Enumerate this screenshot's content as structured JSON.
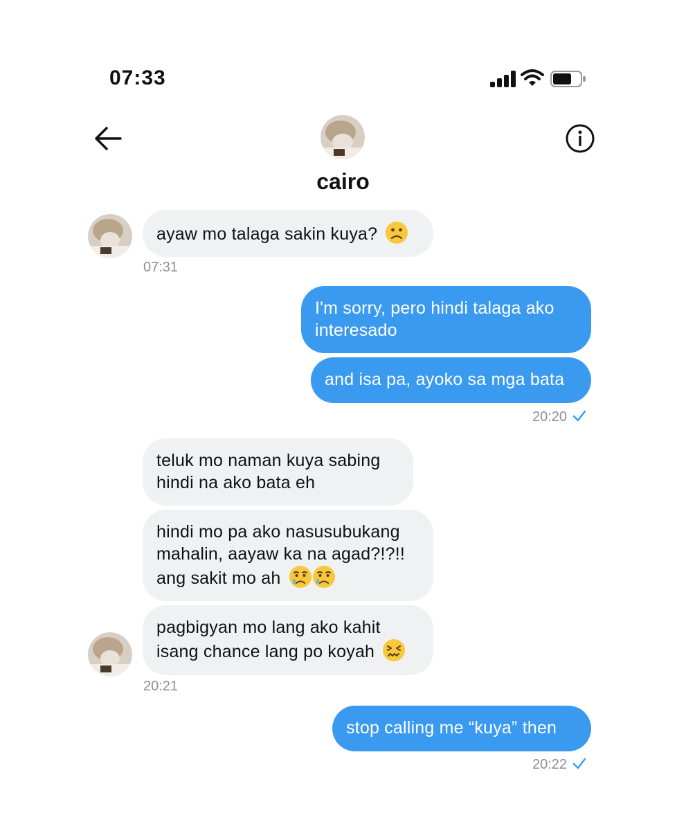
{
  "status_bar": {
    "time": "07:33"
  },
  "header": {
    "contact_name": "cairo"
  },
  "icons": {
    "back": "arrow-left-icon",
    "info": "info-circle-icon",
    "signal": "cellular-signal-icon",
    "wifi": "wifi-icon",
    "battery": "battery-icon"
  },
  "colors": {
    "outgoing_bubble": "#3a9af0",
    "incoming_bubble": "#f0f1f3",
    "read_check": "#3a9af0"
  },
  "messages": [
    {
      "direction": "incoming",
      "text": "ayaw mo talaga sakin kuya?",
      "emoji": "slightly-frowning-face"
    },
    {
      "direction": "incoming",
      "time": "07:31"
    },
    {
      "direction": "outgoing",
      "text_line1": "I'm sorry, pero hindi talaga ako",
      "text_line2": "interesado"
    },
    {
      "direction": "outgoing",
      "text": "and isa pa, ayoko sa mga bata"
    },
    {
      "direction": "outgoing",
      "time": "20:20",
      "status": "read"
    },
    {
      "direction": "incoming",
      "text_line1": "teluk mo naman kuya sabing",
      "text_line2": "hindi na ako bata eh"
    },
    {
      "direction": "incoming",
      "text_line1": "hindi mo pa ako nasusubukang",
      "text_line2": "mahalin, aayaw ka na agad?!?!!",
      "text_line3": "ang sakit mo ah",
      "emoji": "crying-face x2"
    },
    {
      "direction": "incoming",
      "text_line1": "pagbigyan mo lang ako kahit",
      "text_line2": "isang chance lang po koyah",
      "emoji": "confounded-face"
    },
    {
      "direction": "incoming",
      "time": "20:21"
    },
    {
      "direction": "outgoing",
      "text": "stop calling me “kuya” then"
    },
    {
      "direction": "outgoing",
      "time": "20:22",
      "status": "read"
    }
  ]
}
